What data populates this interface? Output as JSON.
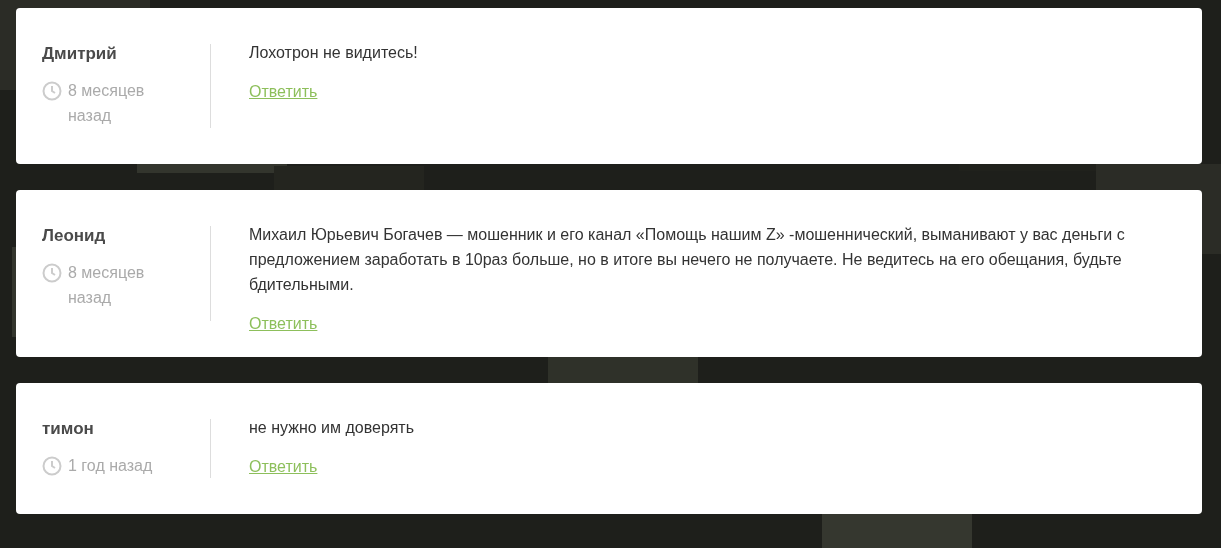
{
  "comments": [
    {
      "author": "Дмитрий",
      "time": "8 месяцев назад",
      "text": "Лохотрон не видитесь!",
      "reply": "Ответить"
    },
    {
      "author": "Леонид",
      "time": "8 месяцев назад",
      "text": "Михаил Юрьевич Богачев — мошенник и его канал «Помощь нашим Z» -мошеннический, выманивают у вас деньги с предложением заработать в 10раз больше, но в итоге вы нечего не получаете. Не ведитесь на его обещания, будьте бдительными.",
      "reply": "Ответить"
    },
    {
      "author": "тимон",
      "time": "1 год назад",
      "text": "не нужно им доверять",
      "reply": "Ответить"
    }
  ]
}
